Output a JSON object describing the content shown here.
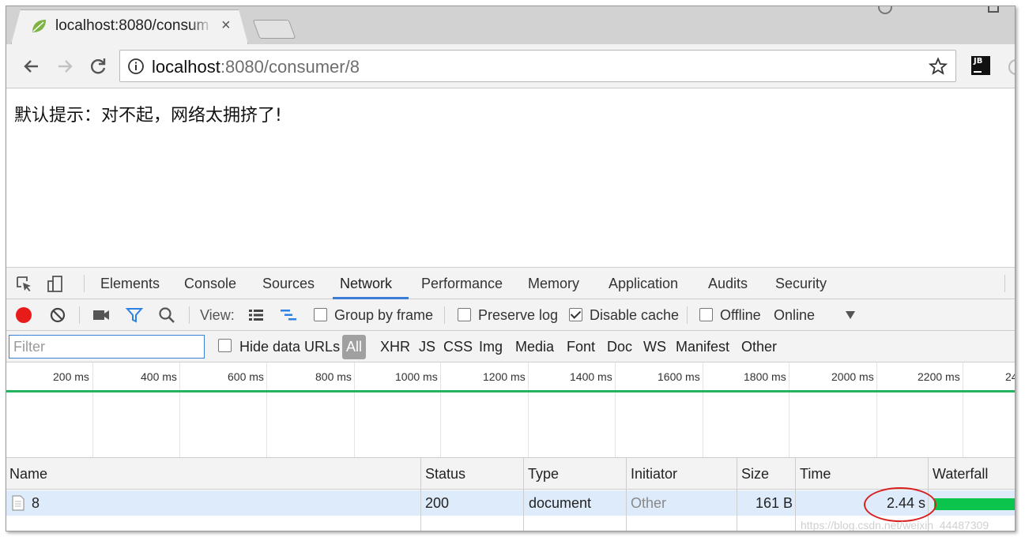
{
  "browser": {
    "tab_title": "localhost:8080/consum",
    "tab_close": "×",
    "url_host": "localhost",
    "url_rest": ":8080/consumer/8",
    "ext_label": "JB"
  },
  "page": {
    "message": "默认提示：对不起，网络太拥挤了!"
  },
  "devtools": {
    "tabs": [
      "Elements",
      "Console",
      "Sources",
      "Network",
      "Performance",
      "Memory",
      "Application",
      "Audits",
      "Security"
    ],
    "active_tab": "Network",
    "toolbar": {
      "view_label": "View:",
      "group_by_frame": "Group by frame",
      "preserve_log": "Preserve log",
      "disable_cache": "Disable cache",
      "offline": "Offline",
      "throttle": "Online"
    },
    "filter": {
      "placeholder": "Filter",
      "hide_data_urls": "Hide data URLs",
      "types": [
        "All",
        "XHR",
        "JS",
        "CSS",
        "Img",
        "Media",
        "Font",
        "Doc",
        "WS",
        "Manifest",
        "Other"
      ]
    },
    "timeline_ticks": [
      "200 ms",
      "400 ms",
      "600 ms",
      "800 ms",
      "1000 ms",
      "1200 ms",
      "1400 ms",
      "1600 ms",
      "1800 ms",
      "2000 ms",
      "2200 ms",
      "24"
    ],
    "columns": [
      "Name",
      "Status",
      "Type",
      "Initiator",
      "Size",
      "Time",
      "Waterfall"
    ],
    "rows": [
      {
        "name": "8",
        "status": "200",
        "type": "document",
        "initiator": "Other",
        "size": "161 B",
        "time": "2.44 s"
      }
    ]
  },
  "watermark": "https://blog.csdn.net/weixin_44487309",
  "colors": {
    "record": "#e81b1b",
    "accent": "#3b7cd8",
    "timeline_green": "#23b45d",
    "waterfall": "#0bc44c",
    "annotation": "#d82020"
  }
}
